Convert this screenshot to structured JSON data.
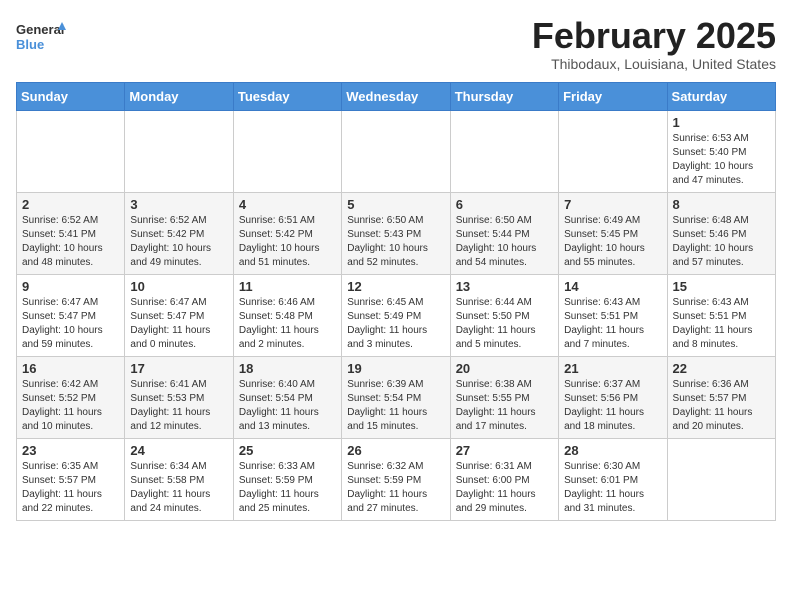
{
  "header": {
    "logo_general": "General",
    "logo_blue": "Blue",
    "title": "February 2025",
    "subtitle": "Thibodaux, Louisiana, United States"
  },
  "days_of_week": [
    "Sunday",
    "Monday",
    "Tuesday",
    "Wednesday",
    "Thursday",
    "Friday",
    "Saturday"
  ],
  "weeks": [
    [
      {
        "day": "",
        "info": ""
      },
      {
        "day": "",
        "info": ""
      },
      {
        "day": "",
        "info": ""
      },
      {
        "day": "",
        "info": ""
      },
      {
        "day": "",
        "info": ""
      },
      {
        "day": "",
        "info": ""
      },
      {
        "day": "1",
        "info": "Sunrise: 6:53 AM\nSunset: 5:40 PM\nDaylight: 10 hours and 47 minutes."
      }
    ],
    [
      {
        "day": "2",
        "info": "Sunrise: 6:52 AM\nSunset: 5:41 PM\nDaylight: 10 hours and 48 minutes."
      },
      {
        "day": "3",
        "info": "Sunrise: 6:52 AM\nSunset: 5:42 PM\nDaylight: 10 hours and 49 minutes."
      },
      {
        "day": "4",
        "info": "Sunrise: 6:51 AM\nSunset: 5:42 PM\nDaylight: 10 hours and 51 minutes."
      },
      {
        "day": "5",
        "info": "Sunrise: 6:50 AM\nSunset: 5:43 PM\nDaylight: 10 hours and 52 minutes."
      },
      {
        "day": "6",
        "info": "Sunrise: 6:50 AM\nSunset: 5:44 PM\nDaylight: 10 hours and 54 minutes."
      },
      {
        "day": "7",
        "info": "Sunrise: 6:49 AM\nSunset: 5:45 PM\nDaylight: 10 hours and 55 minutes."
      },
      {
        "day": "8",
        "info": "Sunrise: 6:48 AM\nSunset: 5:46 PM\nDaylight: 10 hours and 57 minutes."
      }
    ],
    [
      {
        "day": "9",
        "info": "Sunrise: 6:47 AM\nSunset: 5:47 PM\nDaylight: 10 hours and 59 minutes."
      },
      {
        "day": "10",
        "info": "Sunrise: 6:47 AM\nSunset: 5:47 PM\nDaylight: 11 hours and 0 minutes."
      },
      {
        "day": "11",
        "info": "Sunrise: 6:46 AM\nSunset: 5:48 PM\nDaylight: 11 hours and 2 minutes."
      },
      {
        "day": "12",
        "info": "Sunrise: 6:45 AM\nSunset: 5:49 PM\nDaylight: 11 hours and 3 minutes."
      },
      {
        "day": "13",
        "info": "Sunrise: 6:44 AM\nSunset: 5:50 PM\nDaylight: 11 hours and 5 minutes."
      },
      {
        "day": "14",
        "info": "Sunrise: 6:43 AM\nSunset: 5:51 PM\nDaylight: 11 hours and 7 minutes."
      },
      {
        "day": "15",
        "info": "Sunrise: 6:43 AM\nSunset: 5:51 PM\nDaylight: 11 hours and 8 minutes."
      }
    ],
    [
      {
        "day": "16",
        "info": "Sunrise: 6:42 AM\nSunset: 5:52 PM\nDaylight: 11 hours and 10 minutes."
      },
      {
        "day": "17",
        "info": "Sunrise: 6:41 AM\nSunset: 5:53 PM\nDaylight: 11 hours and 12 minutes."
      },
      {
        "day": "18",
        "info": "Sunrise: 6:40 AM\nSunset: 5:54 PM\nDaylight: 11 hours and 13 minutes."
      },
      {
        "day": "19",
        "info": "Sunrise: 6:39 AM\nSunset: 5:54 PM\nDaylight: 11 hours and 15 minutes."
      },
      {
        "day": "20",
        "info": "Sunrise: 6:38 AM\nSunset: 5:55 PM\nDaylight: 11 hours and 17 minutes."
      },
      {
        "day": "21",
        "info": "Sunrise: 6:37 AM\nSunset: 5:56 PM\nDaylight: 11 hours and 18 minutes."
      },
      {
        "day": "22",
        "info": "Sunrise: 6:36 AM\nSunset: 5:57 PM\nDaylight: 11 hours and 20 minutes."
      }
    ],
    [
      {
        "day": "23",
        "info": "Sunrise: 6:35 AM\nSunset: 5:57 PM\nDaylight: 11 hours and 22 minutes."
      },
      {
        "day": "24",
        "info": "Sunrise: 6:34 AM\nSunset: 5:58 PM\nDaylight: 11 hours and 24 minutes."
      },
      {
        "day": "25",
        "info": "Sunrise: 6:33 AM\nSunset: 5:59 PM\nDaylight: 11 hours and 25 minutes."
      },
      {
        "day": "26",
        "info": "Sunrise: 6:32 AM\nSunset: 5:59 PM\nDaylight: 11 hours and 27 minutes."
      },
      {
        "day": "27",
        "info": "Sunrise: 6:31 AM\nSunset: 6:00 PM\nDaylight: 11 hours and 29 minutes."
      },
      {
        "day": "28",
        "info": "Sunrise: 6:30 AM\nSunset: 6:01 PM\nDaylight: 11 hours and 31 minutes."
      },
      {
        "day": "",
        "info": ""
      }
    ]
  ]
}
